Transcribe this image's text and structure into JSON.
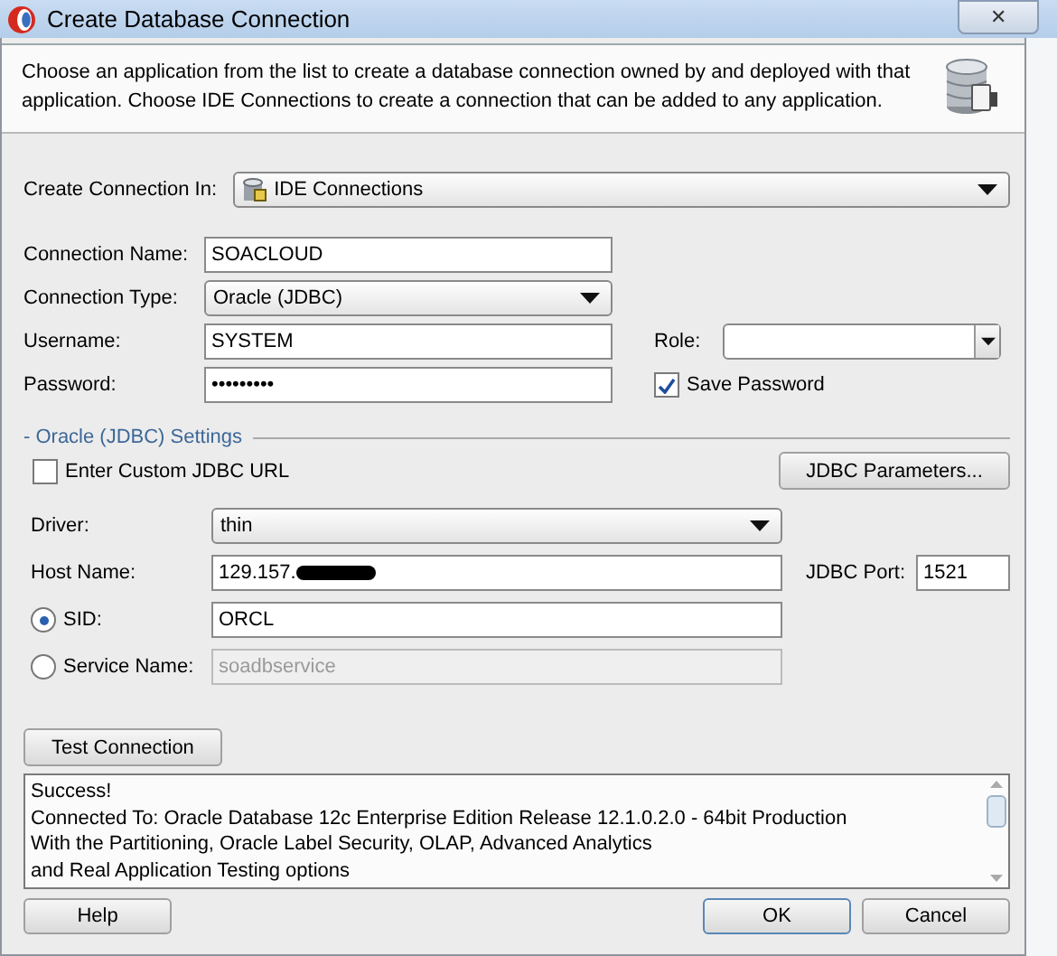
{
  "window": {
    "title": "Create Database Connection",
    "close": "✕"
  },
  "description": "Choose an application from the list to create a database connection owned by and deployed with that application. Choose IDE Connections to create a connection that can be added to any application.",
  "create_connection_in": {
    "label": "Create Connection In:",
    "value": "IDE Connections"
  },
  "fields": [
    {
      "kind": "text",
      "label": "Connection Name:",
      "value": "SOACLOUD"
    },
    {
      "kind": "dropdown",
      "label": "Connection Type:",
      "value": "Oracle (JDBC)"
    },
    {
      "kind": "text",
      "label": "Username:",
      "value": "SYSTEM"
    },
    {
      "kind": "text",
      "label": "Password:",
      "value": "•••••••••"
    }
  ],
  "role": {
    "label": "Role:"
  },
  "save_password": {
    "label": "Save Password",
    "checked": true
  },
  "settings": {
    "title": "- Oracle (JDBC) Settings",
    "custom_url": {
      "label": "Enter Custom JDBC URL",
      "checked": false
    },
    "parameters_button": "JDBC Parameters...",
    "driver": {
      "label": "Driver:",
      "value": "thin"
    },
    "host": {
      "label": "Host Name:",
      "value": "129.157.",
      "redacted": true
    },
    "port": {
      "label": "JDBC Port:",
      "value": "1521"
    },
    "options": [
      {
        "label": "SID:",
        "value": "ORCL",
        "selected": true,
        "disabled": false
      },
      {
        "label": "Service Name:",
        "value": "soadbservice",
        "selected": false,
        "disabled": true
      }
    ]
  },
  "test_button": "Test Connection",
  "log": [
    "Success!",
    "Connected To: Oracle Database 12c Enterprise Edition Release 12.1.0.2.0 - 64bit Production",
    "With the Partitioning, Oracle Label Security, OLAP, Advanced Analytics",
    "and Real Application Testing options"
  ],
  "buttons": [
    {
      "label": "Help",
      "default": false
    },
    {
      "label": "OK",
      "default": true
    },
    {
      "label": "Cancel",
      "default": false
    }
  ]
}
